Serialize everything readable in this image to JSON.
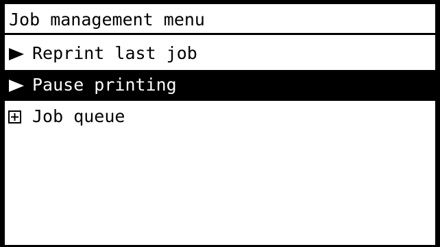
{
  "screen": {
    "title": "Job management menu"
  },
  "menu": {
    "items": [
      {
        "label": "Reprint last job",
        "icon": "arrow-right-icon",
        "selected": false
      },
      {
        "label": "Pause printing",
        "icon": "arrow-right-icon",
        "selected": true
      },
      {
        "label": "Job queue",
        "icon": "expand-plus-icon",
        "selected": false
      }
    ]
  },
  "colors": {
    "background": "#ffffff",
    "foreground": "#000000",
    "selection": "#000000"
  }
}
